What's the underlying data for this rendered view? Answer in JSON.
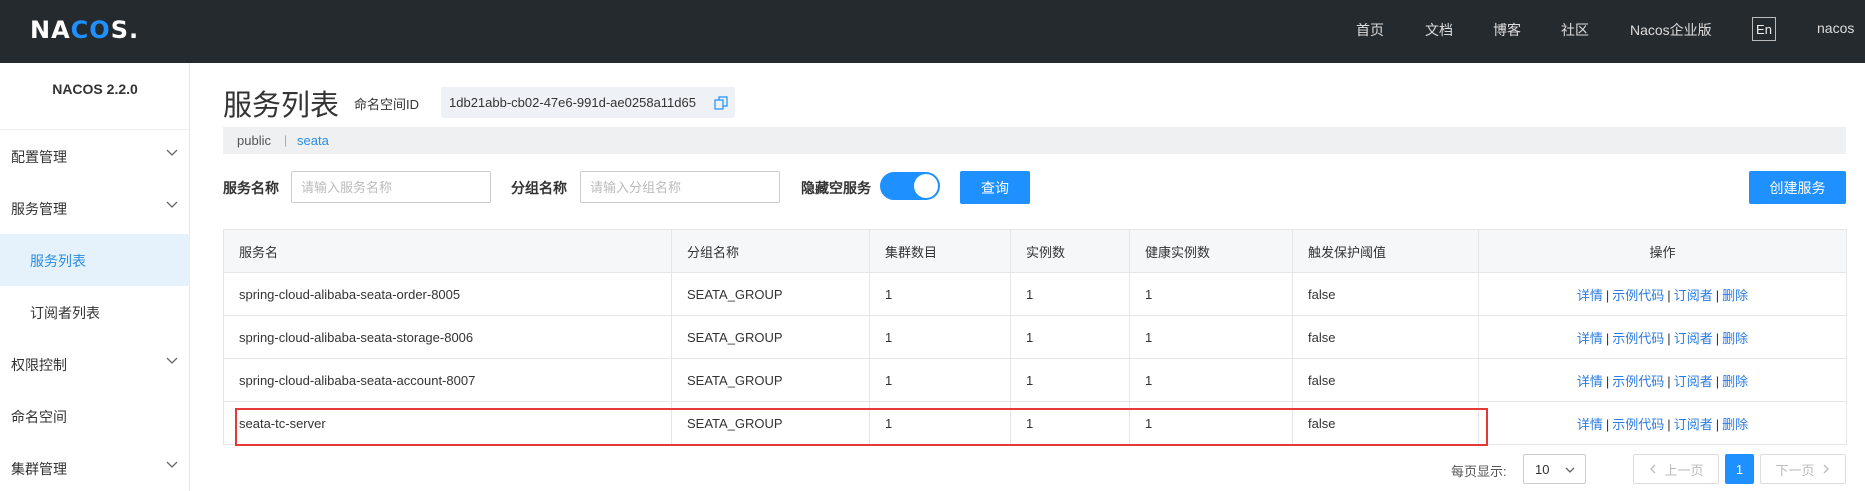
{
  "topbar": {
    "logo_prefix": "NA",
    "logo_o": "C",
    "logo_mid": "O",
    "logo_suffix": "S.",
    "nav": [
      "首页",
      "文档",
      "博客",
      "社区",
      "Nacos企业版"
    ],
    "lang": "En",
    "user": "nacos"
  },
  "sidebar": {
    "version": "NACOS 2.2.0",
    "items": [
      {
        "label": "配置管理"
      },
      {
        "label": "服务管理"
      },
      {
        "label": "服务列表"
      },
      {
        "label": "订阅者列表"
      },
      {
        "label": "权限控制"
      },
      {
        "label": "命名空间"
      },
      {
        "label": "集群管理"
      }
    ]
  },
  "header": {
    "title": "服务列表",
    "ns_label": "命名空间ID",
    "ns_id": "1db21abb-cb02-47e6-991d-ae0258a11d65"
  },
  "namespaces": {
    "public": "public",
    "sep": "|",
    "seata": "seata"
  },
  "filters": {
    "service_label": "服务名称",
    "service_placeholder": "请输入服务名称",
    "group_label": "分组名称",
    "group_placeholder": "请输入分组名称",
    "hide_empty_label": "隐藏空服务",
    "query_button": "查询",
    "create_button": "创建服务"
  },
  "table": {
    "headers": [
      "服务名",
      "分组名称",
      "集群数目",
      "实例数",
      "健康实例数",
      "触发保护阈值",
      "操作"
    ],
    "rows": [
      [
        "spring-cloud-alibaba-seata-order-8005",
        "SEATA_GROUP",
        "1",
        "1",
        "1",
        "false"
      ],
      [
        "spring-cloud-alibaba-seata-storage-8006",
        "SEATA_GROUP",
        "1",
        "1",
        "1",
        "false"
      ],
      [
        "spring-cloud-alibaba-seata-account-8007",
        "SEATA_GROUP",
        "1",
        "1",
        "1",
        "false"
      ],
      [
        "seata-tc-server",
        "SEATA_GROUP",
        "1",
        "1",
        "1",
        "false"
      ]
    ],
    "ops": [
      "详情",
      "示例代码",
      "订阅者",
      "删除"
    ],
    "op_sep": "|"
  },
  "pagination": {
    "per_page_label": "每页显示:",
    "per_page": "10",
    "prev": "上一页",
    "current": "1",
    "next": "下一页"
  },
  "colors": {
    "topbar": "#252a2f",
    "primary": "#1e90ff",
    "highlight": "#e53935"
  }
}
